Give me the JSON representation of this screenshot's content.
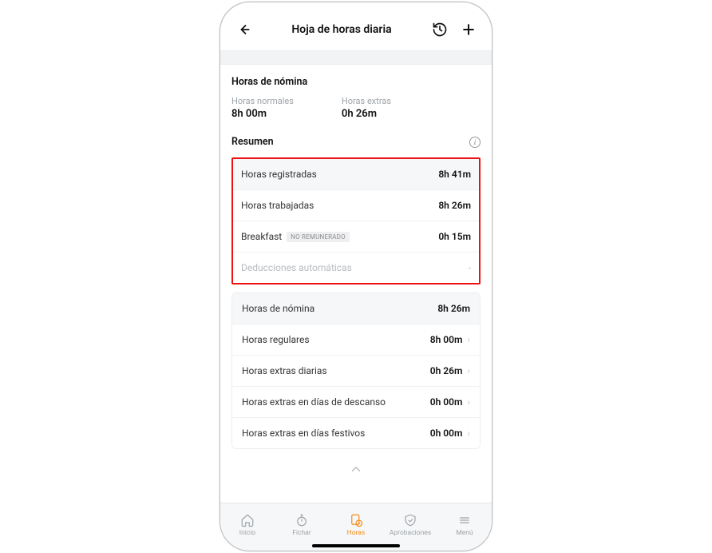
{
  "header": {
    "title": "Hoja de horas diaria"
  },
  "payroll": {
    "section_title": "Horas de nómina",
    "normal_label": "Horas normales",
    "normal_value": "8h 00m",
    "extra_label": "Horas extras",
    "extra_value": "0h 26m"
  },
  "resumen": {
    "title": "Resumen",
    "rows": [
      {
        "label": "Horas registradas",
        "value": "8h 41m"
      },
      {
        "label": "Horas trabajadas",
        "value": "8h 26m"
      },
      {
        "label": "Breakfast",
        "badge": "NO REMUNERADO",
        "value": "0h 15m"
      },
      {
        "label": "Deducciones automáticas",
        "value": "-",
        "disabled": true
      }
    ]
  },
  "breakdown": {
    "head": {
      "label": "Horas de nómina",
      "value": "8h 26m"
    },
    "rows": [
      {
        "label": "Horas regulares",
        "value": "8h 00m"
      },
      {
        "label": "Horas extras diarias",
        "value": "0h 26m"
      },
      {
        "label": "Horas extras en días de descanso",
        "value": "0h 00m"
      },
      {
        "label": "Horas extras en días festivos",
        "value": "0h 00m"
      }
    ]
  },
  "tabs": {
    "inicio": "Inicio",
    "fichar": "Fichar",
    "horas": "Horas",
    "aprobaciones": "Aprobaciones",
    "menu": "Menú"
  }
}
